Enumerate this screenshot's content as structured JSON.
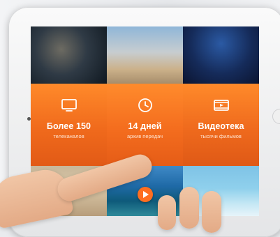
{
  "features": [
    {
      "title": "Более 150",
      "subtitle": "телеканалов",
      "icon": "tv-icon"
    },
    {
      "title": "14 дней",
      "subtitle": "архив передач",
      "icon": "clock-icon"
    },
    {
      "title": "Видеотека",
      "subtitle": "тысячи фильмов",
      "icon": "film-icon"
    }
  ],
  "colors": {
    "accent": "#f06a1c",
    "accent_light": "#ff8a2a",
    "text_light": "#ffe4d1"
  }
}
